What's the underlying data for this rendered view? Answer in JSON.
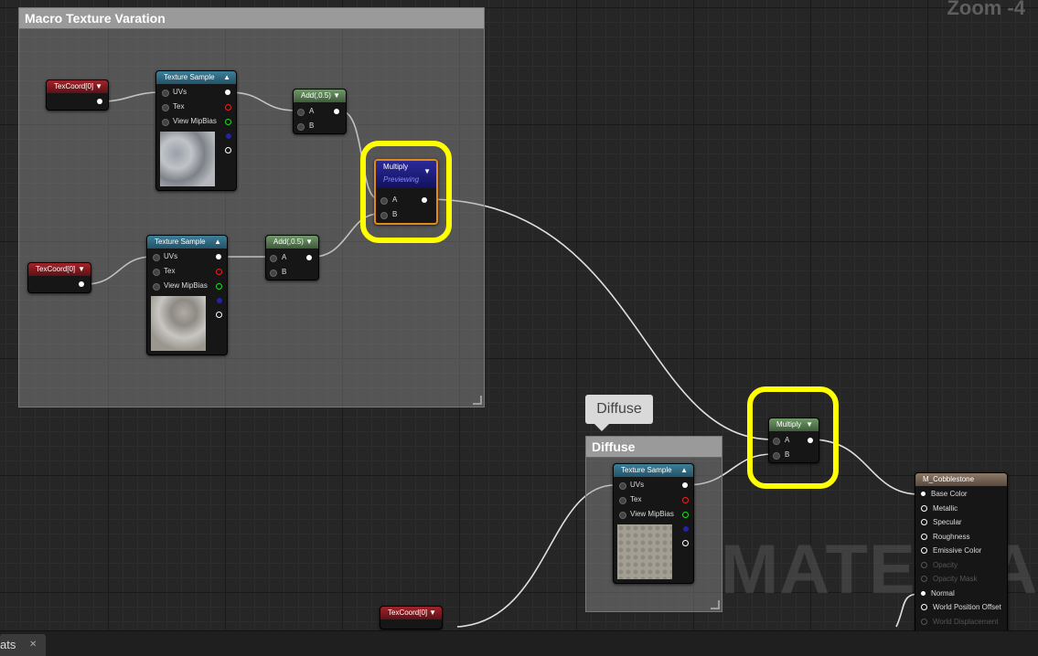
{
  "zoom_label": "Zoom -4",
  "watermark": "MATERIAL",
  "comments": {
    "macro": "Macro Texture Varation",
    "diffuse": "Diffuse"
  },
  "bubble": "Diffuse",
  "nodes": {
    "texcoord_label": "TexCoord[0]",
    "texture_sample": {
      "title": "Texture Sample",
      "uvs": "UVs",
      "tex": "Tex",
      "view_mip_bias": "View MipBias"
    },
    "add_title": "Add(,0.5)",
    "multiply_title": "Multiply",
    "previewing": "Previewing",
    "pin_a": "A",
    "pin_b": "B"
  },
  "material": {
    "title": "M_Cobblestone",
    "inputs": [
      "Base Color",
      "Metallic",
      "Specular",
      "Roughness",
      "Emissive Color",
      "Opacity",
      "Opacity Mask",
      "Normal",
      "World Position Offset",
      "World Displacement"
    ]
  },
  "status_tab": "ats",
  "icons": {
    "dropdown": "dropdown-arrow-icon",
    "close": "close-icon"
  }
}
